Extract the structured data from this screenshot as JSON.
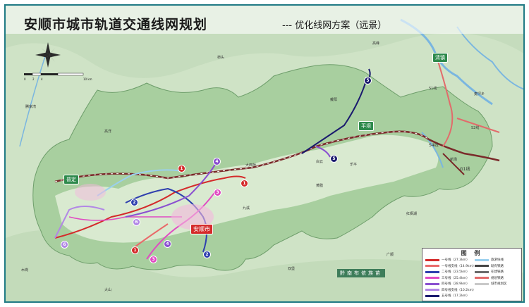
{
  "title": "安顺市城市轨道交通线网规划",
  "subtitle": "--- 优化线网方案（远景）",
  "legend": {
    "title": "图 例",
    "items": [
      {
        "label": "一号线（27.3km）",
        "color": "#d42a2a"
      },
      {
        "label": "一号线支线（14.9km）",
        "color": "#e96a6a"
      },
      {
        "label": "二号线（23.5km）",
        "color": "#2e3fae"
      },
      {
        "label": "三号线（25.4km）",
        "color": "#e04ac2"
      },
      {
        "label": "四号线（28.9km）",
        "color": "#8a4fd0"
      },
      {
        "label": "四号线支线（10.2km）",
        "color": "#b287e6"
      },
      {
        "label": "五号线（17.2km）",
        "color": "#1a1a6e"
      },
      {
        "label": "旅游快线",
        "color": "#9ad0ee"
      },
      {
        "label": "既有铁路",
        "color": "#444444"
      },
      {
        "label": "在建铁路",
        "color": "#6a6a6a"
      },
      {
        "label": "规划铁路",
        "color": "#e26b6b"
      },
      {
        "label": "城市规划区",
        "color": "#c9c9c9"
      }
    ]
  },
  "places": {
    "anshun": "安顺市",
    "puding": "普定",
    "pingba": "平坝",
    "qingzhen": "清镇",
    "daxiqiao": "大西桥",
    "baiyun": "白云",
    "leguan": "乐平",
    "huangla": "黄腊",
    "gaofeng": "高峰",
    "kaiyang": "戴阳",
    "xinyan": "新场",
    "guangshun": "广顺",
    "shuanghe": "双堡",
    "dashan": "大山",
    "muguan": "木岗",
    "yanjiaoxiang": "腾家湾",
    "qiannanbuyi": "黔南布依族苗",
    "qiaotou": "桥头",
    "hongfeng": "红枫湖",
    "s1": "S1线",
    "s2": "S2线",
    "s4": "S4线",
    "g1": "G1线",
    "jiumi": "九溪",
    "maiweng": "麦坪乡",
    "gaoyang": "高洋"
  },
  "line_badges": [
    "1",
    "2",
    "3",
    "4",
    "5",
    "6"
  ],
  "scale": {
    "labels": [
      "0",
      "2",
      "4",
      "10 km"
    ]
  },
  "colors": {
    "line1": "#d42a2a",
    "line2": "#2e3fae",
    "line3": "#e04ac2",
    "line4": "#8a4fd0",
    "line5": "#1a1a6e",
    "line6": "#b287e6",
    "tourist": "#9ad0ee",
    "railway": "#444444",
    "planned_rail": "#e26b6b",
    "city_badge": "#2e8a4c",
    "river": "#7ab6e0",
    "region_light": "#c5dfb8",
    "region_dark": "#9fc79b"
  }
}
